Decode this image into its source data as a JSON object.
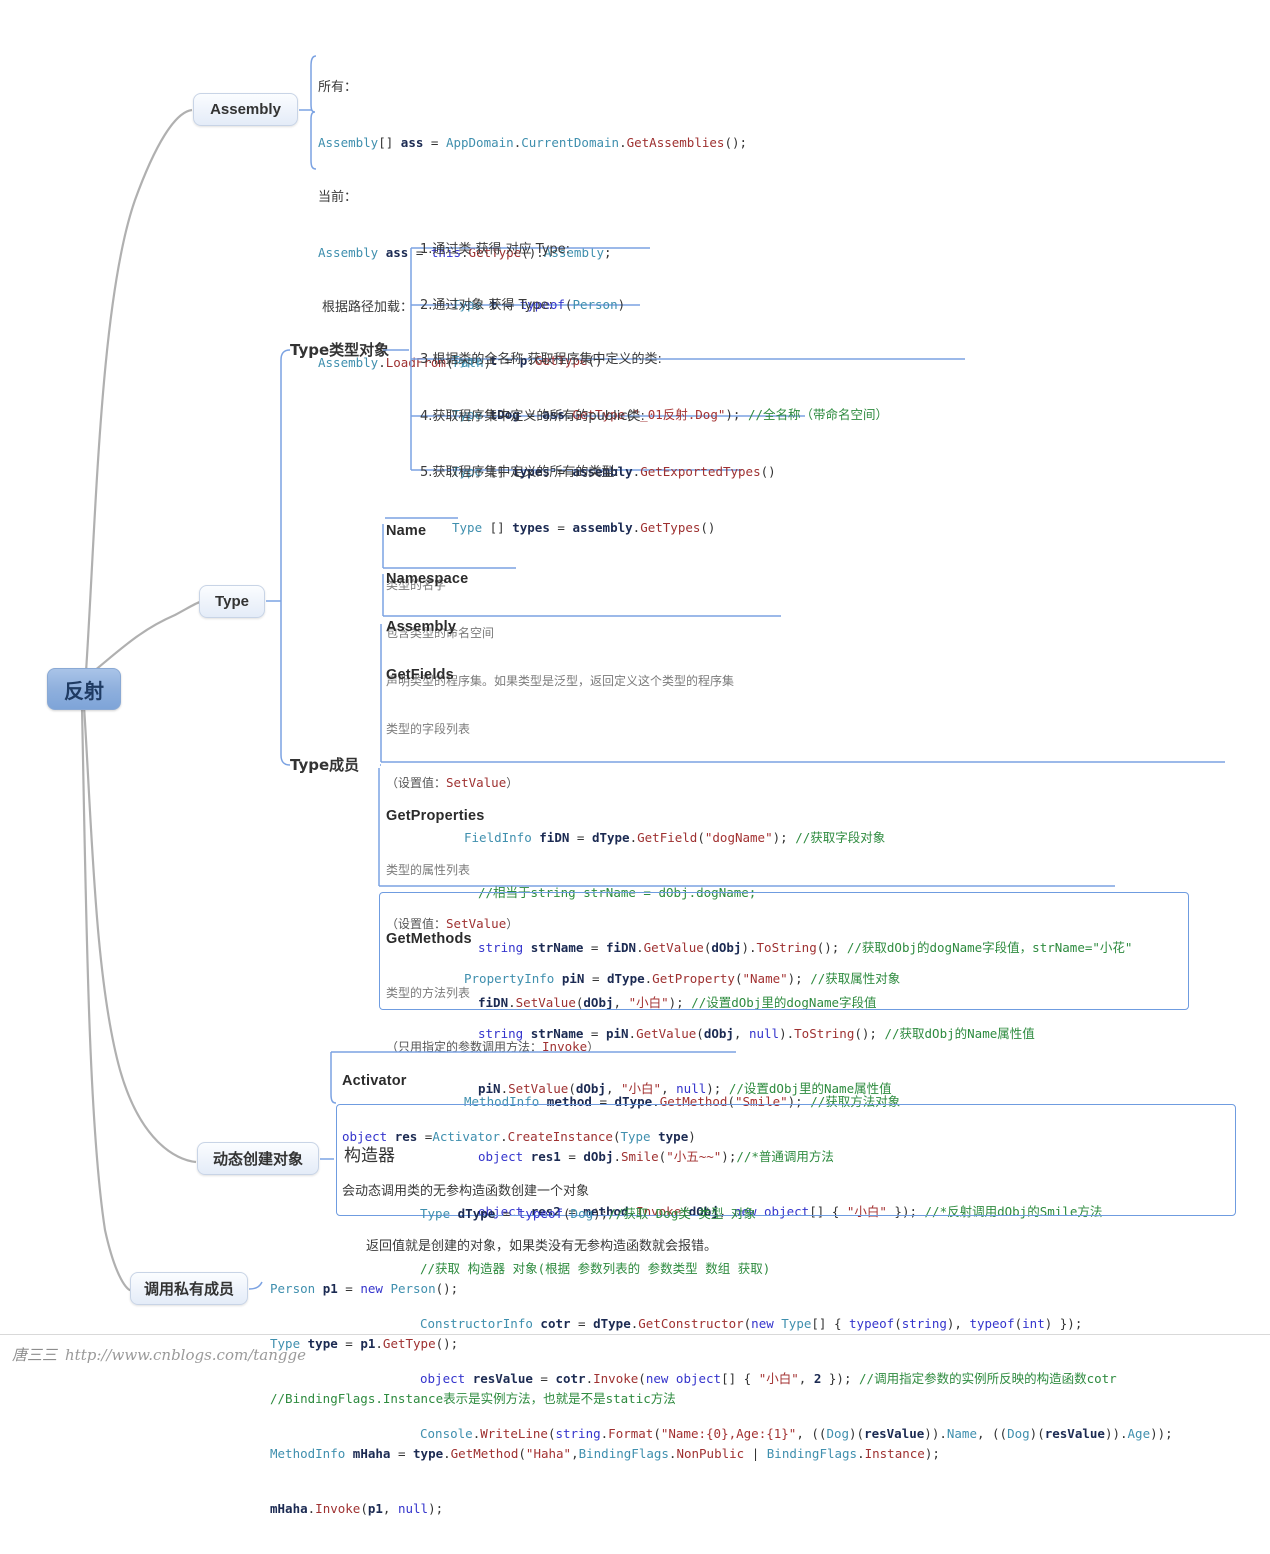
{
  "root": {
    "label": "反射"
  },
  "branches": {
    "assembly": {
      "label": "Assembly"
    },
    "type": {
      "label": "Type"
    },
    "dynamic_create": {
      "label": "动态创建对象"
    },
    "private_member": {
      "label": "调用私有成员"
    }
  },
  "sublabels": {
    "type_object": "Type类型对象",
    "type_member": "Type成员"
  },
  "assembly_block": {
    "l1_label": "所有：",
    "l2_code": "Assembly[] ass = AppDomain.CurrentDomain.GetAssemblies();",
    "l3_label": "当前：",
    "l4_code": "Assembly ass = this.GetType().Assembly;",
    "l5_label": "根据路径加载：",
    "l6_code": "Assembly.LoadFrom(Path)"
  },
  "type_object_items": [
    {
      "title": "1.通过类 获得 对应 Type:",
      "code": "Type t = typeof(Person)"
    },
    {
      "title": "2.通过对象 获得 Type:",
      "code": "Type t = p.GetType()"
    },
    {
      "title": "3.根据类的全名称 获取程序集中定义的类:",
      "code": "Type tDog = ass.GetType(\"_01反射.Dog\"); //全名称（带命名空间）"
    },
    {
      "title": "4.获取程序集中定义的所有的public类:",
      "code": "Type [] types = assembly.GetExportedTypes()"
    },
    {
      "title": "5.获取程序集中定义的所有的类型:",
      "code": "Type [] types = assembly.GetTypes()"
    }
  ],
  "type_members": [
    {
      "name": "Name",
      "desc": "类型的名字"
    },
    {
      "name": "Namespace",
      "desc": "包含类型的命名空间"
    },
    {
      "name": "Assembly",
      "desc": "声明类型的程序集。如果类型是泛型，返回定义这个类型的程序集"
    },
    {
      "name": "GetFields",
      "desc": "类型的字段列表",
      "note_prefix": "（设置值：",
      "note_api": "SetValue",
      "note_suffix": "）",
      "code": [
        "FieldInfo fiDN = dType.GetField(\"dogName\"); //获取字段对象",
        "//相当于string strName = dObj.dogName;",
        "string strName = fiDN.GetValue(dObj).ToString(); //获取dObj的dogName字段值，strName=\"小花\"",
        "fiDN.SetValue(dObj, \"小白\"); //设置dObj里的dogName字段值"
      ]
    },
    {
      "name": "GetProperties",
      "desc": "类型的属性列表",
      "note_prefix": "（设置值：",
      "note_api": "SetValue",
      "note_suffix": "）",
      "code": [
        "PropertyInfo piN = dType.GetProperty(\"Name\"); //获取属性对象",
        "string strName = piN.GetValue(dObj, null).ToString(); //获取dObj的Name属性值",
        "piN.SetValue(dObj, \"小白\", null); //设置dObj里的Name属性值"
      ]
    },
    {
      "name": "GetMethods",
      "desc": "类型的方法列表",
      "note_prefix": "（只用指定的参数调用方法：",
      "note_api": "Invoke",
      "note_suffix": "）",
      "code": [
        "MethodInfo method = dType.GetMethod(\"Smile\"); //获取方法对象",
        "object res1 = dObj.Smile(\"小五~~\");//*普通调用方法",
        "object res2 = method.Invoke(dObj, new object[] { \"小白\" }); //*反射调用dObj的Smile方法"
      ]
    }
  ],
  "activator": {
    "title": "Activator",
    "code": "object res =Activator.CreateInstance(Type type)",
    "desc1": "会动态调用类的无参构造函数创建一个对象",
    "desc2": "返回值就是创建的对象，如果类没有无参构造函数就会报错。"
  },
  "constructor": {
    "title": "构造器",
    "code": [
      "Type dType = typeof(Dog);//获取 Dog类 类型 对象",
      "//获取 构造器 对象(根据 参数列表的 参数类型 数组 获取)",
      "ConstructorInfo cotr = dType.GetConstructor(new Type[] { typeof(string), typeof(int) });",
      "object resValue = cotr.Invoke(new object[] { \"小白\", 2 }); //调用指定参数的实例所反映的构造函数cotr",
      "Console.WriteLine(string.Format(\"Name:{0},Age:{1}\", ((Dog)(resValue)).Name, ((Dog)(resValue)).Age));"
    ]
  },
  "private_member_code": [
    "Person p1 = new Person();",
    "Type type = p1.GetType();",
    "//BindingFlags.Instance表示是实例方法，也就是不是static方法",
    "MethodInfo mHaha = type.GetMethod(\"Haha\",BindingFlags.NonPublic | BindingFlags.Instance);",
    "mHaha.Invoke(p1, null);"
  ],
  "watermark": {
    "author": "唐三三",
    "url": "http://www.cnblogs.com/tangge"
  },
  "colors": {
    "accent_line": "#6f9ce0",
    "root_fill": "#8fb0dd",
    "branch_fill": "#eef3fb",
    "type_color": "#3f8fae",
    "keyword_color": "#3434cc",
    "method_color": "#9e3030",
    "comment_color": "#2e8b3f"
  }
}
